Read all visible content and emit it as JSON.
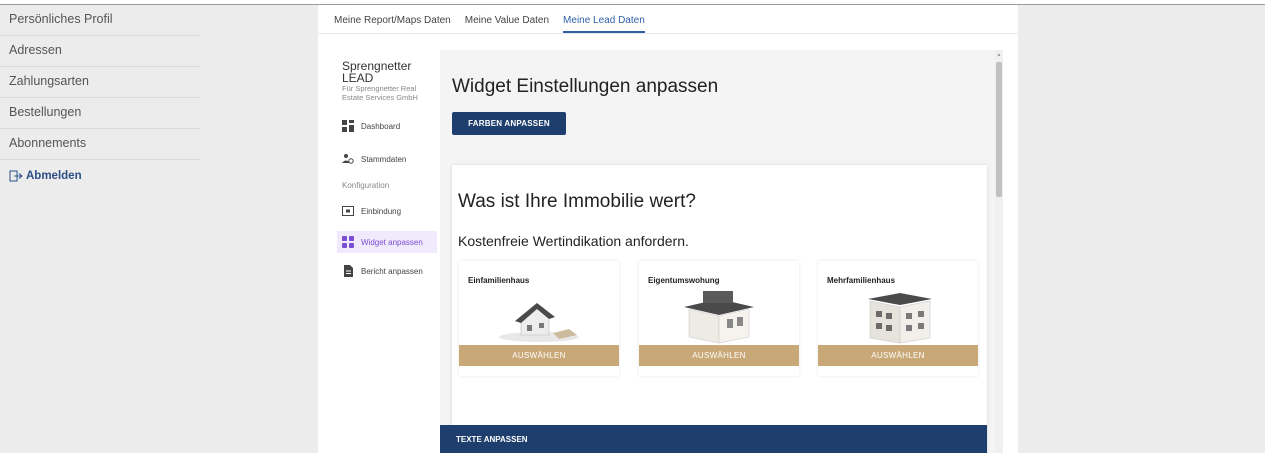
{
  "account_menu": {
    "items": [
      {
        "label": "Persönliches Profil"
      },
      {
        "label": "Adressen"
      },
      {
        "label": "Zahlungsarten"
      },
      {
        "label": "Bestellungen"
      },
      {
        "label": "Abonnements"
      }
    ],
    "logout_label": "Abmelden"
  },
  "tabs": [
    {
      "label": "Meine Report/Maps Daten",
      "active": false
    },
    {
      "label": "Meine Value Daten",
      "active": false
    },
    {
      "label": "Meine Lead Daten",
      "active": true
    }
  ],
  "brand": {
    "name_line1": "Sprengnetter",
    "name_line2": "LEAD",
    "sub_line1": "Für Sprengnetter Real",
    "sub_line2": "Estate Services GmbH"
  },
  "nav": {
    "dashboard": "Dashboard",
    "stammdaten": "Stammdaten",
    "section_label": "Konfiguration",
    "einbindung": "Einbindung",
    "widget": "Widget anpassen",
    "bericht": "Bericht anpassen"
  },
  "content": {
    "title": "Widget Einstellungen anpassen",
    "colors_button": "FARBEN ANPASSEN",
    "widget_heading": "Was ist Ihre Immobilie wert?",
    "widget_subheading": "Kostenfreie Wertindikation anfordern.",
    "properties": [
      {
        "label": "Einfamilienhaus",
        "button": "AUSWÄHLEN"
      },
      {
        "label": "Eigentumswohung",
        "button": "AUSWÄHLEN"
      },
      {
        "label": "Mehrfamilienhaus",
        "button": "AUSWÄHLEN"
      }
    ],
    "texts_button": "TEXTE ANPASSEN"
  },
  "colors": {
    "primary": "#1e3f6e",
    "accent_gold": "#c9a878",
    "active_tab": "#2f5fa8",
    "active_nav": "#7b4fd3",
    "logout": "#2b4f86"
  },
  "icons": {
    "logout": "logout-icon",
    "dashboard": "dashboard-icon",
    "stammdaten": "users-icon",
    "einbindung": "embed-icon",
    "widget": "widget-grid-icon",
    "bericht": "document-icon"
  }
}
